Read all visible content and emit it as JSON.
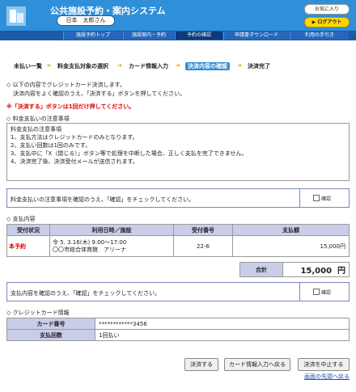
{
  "header": {
    "title": "公共施設予約・案内システム",
    "user": "日本　太郎さん",
    "favorites": "お気に入り",
    "logout": "▶ ログアウト"
  },
  "nav": [
    "施設予約トップ",
    "施設案内・予約",
    "予約の確認",
    "申請書ダウンロード",
    "利用の手引き"
  ],
  "steps": [
    "未払い一覧",
    "料金支払対象の選択",
    "カード情報入力",
    "決済内容の確認",
    "決済完了"
  ],
  "intro": {
    "line1": "◇ 以下の内容でクレジットカード決済します。",
    "line2": "決済内容をよく確認のうえ、「決済する」ボタンを押してください。",
    "warning": "※「決済する」ボタンは1回だけ押してください。"
  },
  "notes": {
    "heading": "◇ 料金支払いの注意事項",
    "title": "料金支払の注意事項",
    "items": [
      "1、支払方法はクレジットカードのみとなります。",
      "2、支払い回数は1回のみです。",
      "3、支払中に「X（閉じる）」ボタン等で処理を中断した場合、正しく支払を完了できません。",
      "4、決済完了後、決済受付メールが送信されます。"
    ],
    "confirm_text": "料金支払いの注意事項を確認のうえ、「確認」をチェックしてください。",
    "confirm_label": "確認"
  },
  "payment": {
    "heading": "◇ 支払内容",
    "columns": [
      "受付状況",
      "利用日時／施設",
      "受付番号",
      "支払額"
    ],
    "row": {
      "status": "本予約",
      "datetime": "令 5. 3.16(木)  9:00～17:00",
      "facility": "〇〇市総合体育館　アリーナ",
      "number": "22-6",
      "amount": "15,000円"
    },
    "total_label": "合計",
    "total_value": "15,000",
    "total_unit": "円",
    "confirm_text": "支払内容を確認のうえ、「確認」をチェックしてください。",
    "confirm_label": "確認"
  },
  "card": {
    "heading": "◇ クレジットカード情報",
    "number_label": "カード番号",
    "number_value": "************3456",
    "count_label": "支払回数",
    "count_value": "1回払い"
  },
  "buttons": {
    "pay": "決済する",
    "back": "カード情報入力へ戻る",
    "cancel": "決済を中止する"
  },
  "top_link": "画面の先頭へ戻る"
}
